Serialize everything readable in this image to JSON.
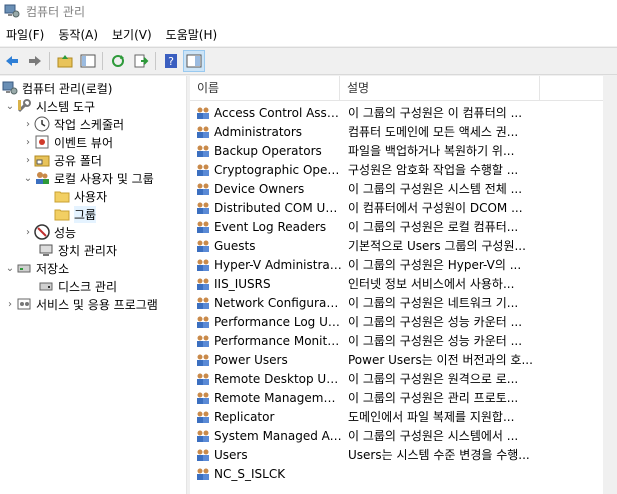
{
  "window": {
    "title": "컴퓨터 관리"
  },
  "menu": [
    "파일(F)",
    "동작(A)",
    "보기(V)",
    "도움말(H)"
  ],
  "toolbar": {
    "buttons": [
      "back-icon",
      "forward-icon",
      "up-folder-icon",
      "show-hide-tree-icon",
      "refresh-icon",
      "export-icon",
      "help-icon",
      "properties-icon"
    ]
  },
  "tree": {
    "items": [
      {
        "label": "컴퓨터 관리(로컬)",
        "icon": "computer-management-icon"
      },
      {
        "label": "시스템 도구",
        "icon": "tools-icon"
      },
      {
        "label": "작업 스케줄러",
        "icon": "clock-icon"
      },
      {
        "label": "이벤트 뷰어",
        "icon": "event-viewer-icon"
      },
      {
        "label": "공유 폴더",
        "icon": "shared-folder-icon"
      },
      {
        "label": "로컬 사용자 및 그룹",
        "icon": "users-icon"
      },
      {
        "label": "사용자",
        "icon": "folder-icon"
      },
      {
        "label": "그룹",
        "icon": "folder-icon"
      },
      {
        "label": "성능",
        "icon": "performance-icon"
      },
      {
        "label": "장치 관리자",
        "icon": "device-manager-icon"
      },
      {
        "label": "저장소",
        "icon": "storage-icon"
      },
      {
        "label": "디스크 관리",
        "icon": "disk-icon"
      },
      {
        "label": "서비스 및 응용 프로그램",
        "icon": "services-icon"
      }
    ]
  },
  "list": {
    "columns": [
      "이름",
      "설명"
    ],
    "rows": [
      {
        "name": "Access Control Assist...",
        "desc": "이 그룹의 구성원은 이 컴퓨터의 ..."
      },
      {
        "name": "Administrators",
        "desc": "컴퓨터 도메인에 모든 액세스 권..."
      },
      {
        "name": "Backup Operators",
        "desc": "파일을 백업하거나 복원하기 위..."
      },
      {
        "name": "Cryptographic Operat...",
        "desc": "구성원은 암호화 작업을 수행할 ..."
      },
      {
        "name": "Device Owners",
        "desc": "이 그룹의 구성원은 시스템 전체 ..."
      },
      {
        "name": "Distributed COM Users",
        "desc": "이 컴퓨터에서 구성원이 DCOM ..."
      },
      {
        "name": "Event Log Readers",
        "desc": "이 그룹의 구성원은 로컬 컴퓨터..."
      },
      {
        "name": "Guests",
        "desc": "기본적으로 Users 그룹의 구성원..."
      },
      {
        "name": "Hyper-V Administrat...",
        "desc": "이 그룹의 구성원은 Hyper-V의 ..."
      },
      {
        "name": "IIS_IUSRS",
        "desc": "인터넷 정보 서비스에서 사용하..."
      },
      {
        "name": "Network Configuratio...",
        "desc": "이 그룹의 구성원은 네트워크 기..."
      },
      {
        "name": "Performance Log Users",
        "desc": "이 그룹의 구성원은 성능 카운터 ..."
      },
      {
        "name": "Performance Monitor...",
        "desc": "이 그룹의 구성원은 성능 카운터 ..."
      },
      {
        "name": "Power Users",
        "desc": "Power Users는 이전 버전과의 호..."
      },
      {
        "name": "Remote Desktop Users",
        "desc": "이 그룹의 구성원은 원격으로 로..."
      },
      {
        "name": "Remote Management...",
        "desc": "이 그룹의 구성원은 관리 프로토..."
      },
      {
        "name": "Replicator",
        "desc": "도메인에서 파일 복제를 지원합..."
      },
      {
        "name": "System Managed Acc...",
        "desc": "이 그룹의 구성원은 시스템에서 ..."
      },
      {
        "name": "Users",
        "desc": "Users는 시스템 수준 변경을 수행..."
      },
      {
        "name": "NC_S_ISLCK",
        "desc": ""
      }
    ]
  },
  "colors": {
    "selection": "#e5f3ff",
    "accent": "#0078d7"
  }
}
